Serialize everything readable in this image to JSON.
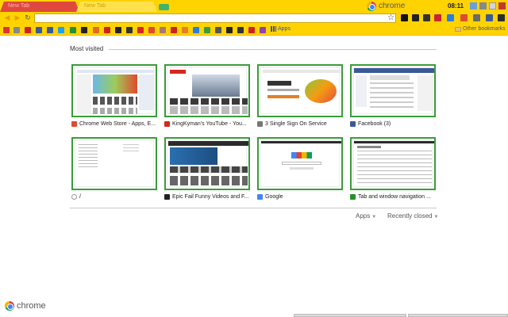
{
  "tabs": [
    {
      "label": "New Tab",
      "active": false
    },
    {
      "label": "New Tab",
      "active": true
    }
  ],
  "brand": {
    "name": "chrome"
  },
  "clock": "08:11",
  "omnibox": {
    "value": "",
    "placeholder": ""
  },
  "bookmarks": {
    "apps_label": "Apps",
    "other_label": "Other bookmarks"
  },
  "most_visited": {
    "title": "Most visited",
    "tiles": [
      {
        "title": "Chrome Web Store - Apps, E...",
        "favicon": "chrome-web-store-icon",
        "color": "#e04a2f"
      },
      {
        "title": "KingKyman's YouTube - You...",
        "favicon": "youtube-icon",
        "color": "#d9261c"
      },
      {
        "title": "3 Single Sign On Service",
        "favicon": "sso-service-icon",
        "color": "#777777"
      },
      {
        "title": "Facebook (3)",
        "favicon": "facebook-icon",
        "color": "#3b5998"
      },
      {
        "title": "/",
        "favicon": "globe-icon",
        "color": "#999999"
      },
      {
        "title": "Epic Fail Funny Videos and F...",
        "favicon": "epic-fail-icon",
        "color": "#222222"
      },
      {
        "title": "Google",
        "favicon": "google-icon",
        "color": "#4285f4"
      },
      {
        "title": "Tab and window navigation ...",
        "favicon": "google-docs-icon",
        "color": "#2a8f2a"
      }
    ]
  },
  "footer": {
    "apps_label": "Apps",
    "recently_closed_label": "Recently closed"
  },
  "colors": {
    "theme": "#ffd300",
    "tile_border": "#3a9c3a"
  }
}
